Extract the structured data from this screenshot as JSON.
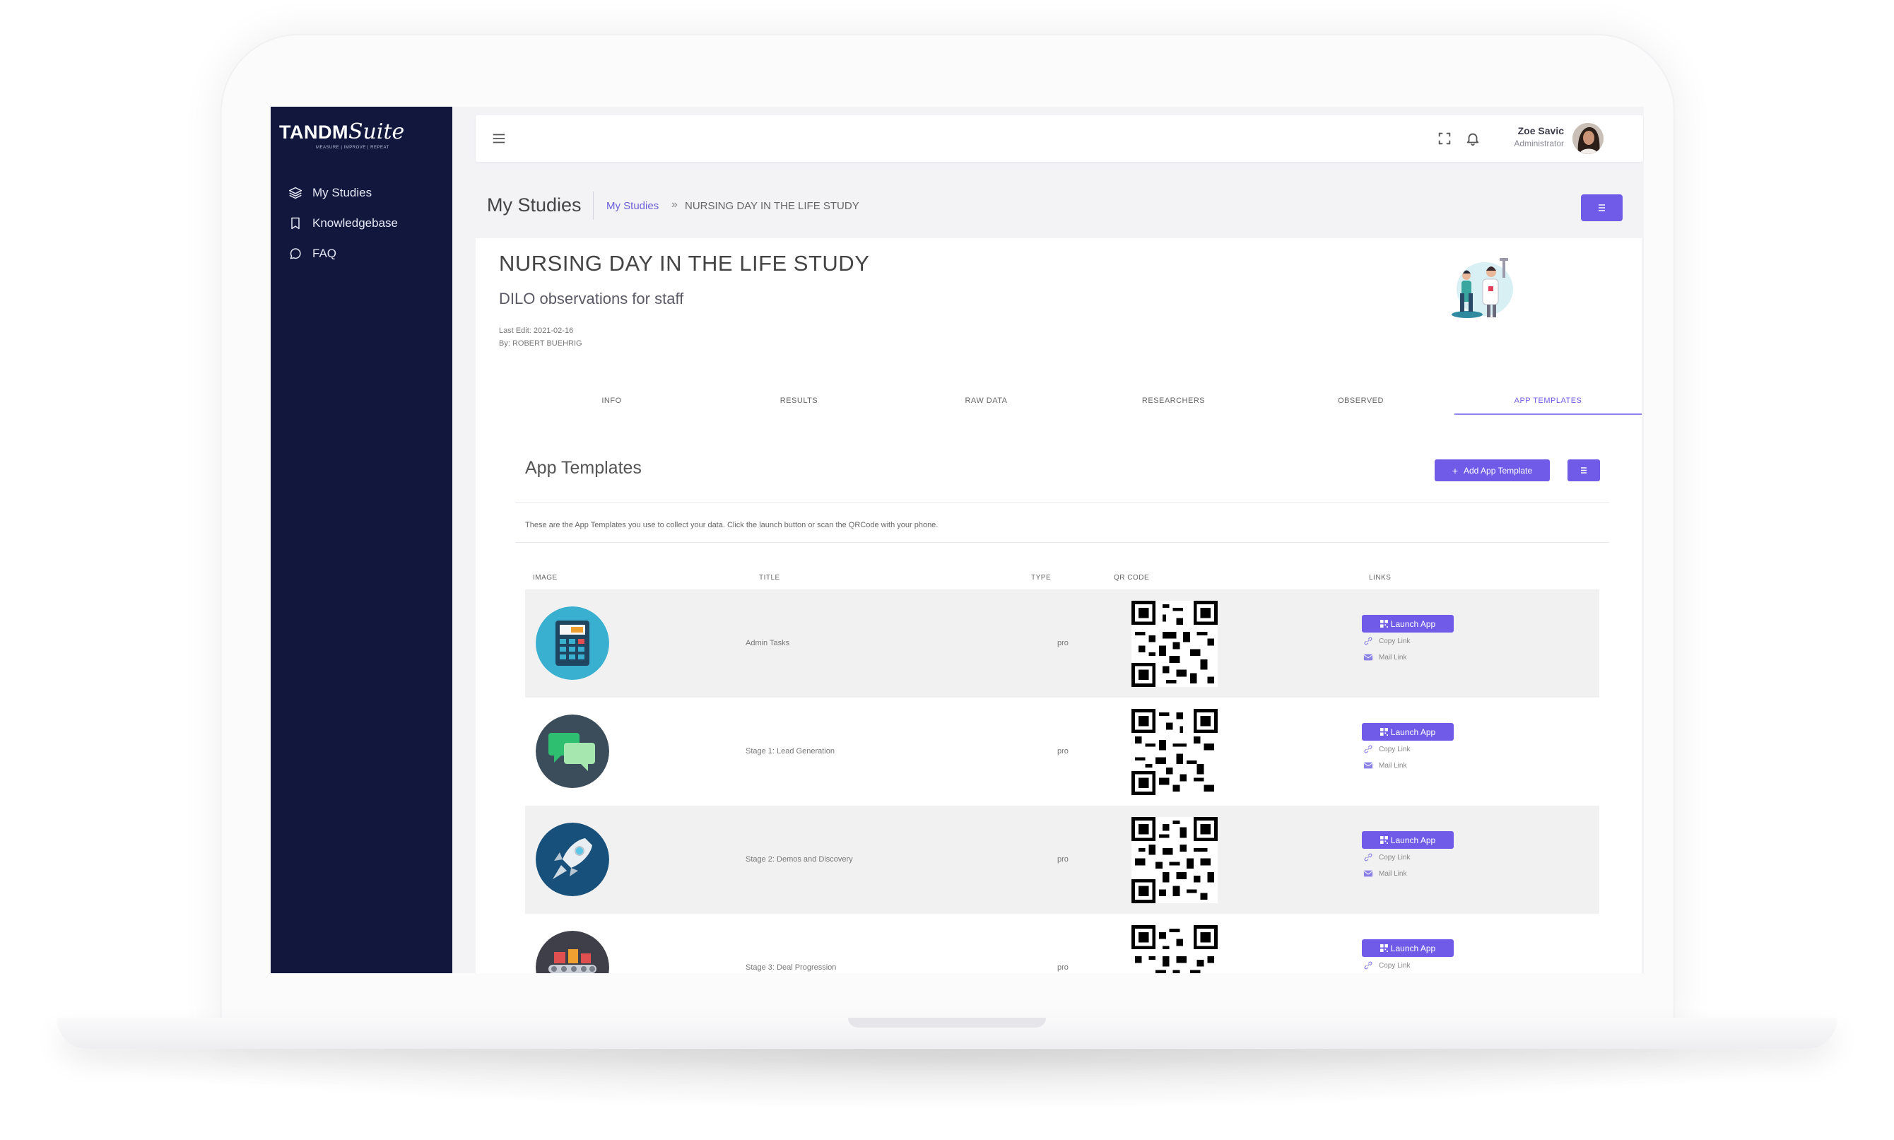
{
  "brand": {
    "logo_main": "TANDM",
    "logo_script": "Suite",
    "logo_tagline": "MEASURE | IMPROVE | REPEAT"
  },
  "sidebar": {
    "items": [
      {
        "label": "My Studies",
        "icon": "layers-icon"
      },
      {
        "label": "Knowledgebase",
        "icon": "bookmark-icon"
      },
      {
        "label": "FAQ",
        "icon": "chat-bubble-icon"
      }
    ]
  },
  "topbar": {
    "user_name": "Zoe Savic",
    "user_role": "Administrator"
  },
  "breadcrumb": {
    "page_title": "My Studies",
    "link": "My Studies",
    "separator": "»",
    "current": "NURSING DAY IN THE LIFE STUDY"
  },
  "study": {
    "title": "NURSING DAY IN THE LIFE STUDY",
    "subtitle": "DILO observations for staff",
    "last_edit": "Last Edit: 2021-02-16",
    "by": "By: ROBERT BUEHRIG"
  },
  "tabs": [
    {
      "label": "INFO",
      "active": false
    },
    {
      "label": "RESULTS",
      "active": false
    },
    {
      "label": "RAW DATA",
      "active": false
    },
    {
      "label": "RESEARCHERS",
      "active": false
    },
    {
      "label": "OBSERVED",
      "active": false
    },
    {
      "label": "APP TEMPLATES",
      "active": true
    }
  ],
  "templates": {
    "title": "App Templates",
    "add_button": "Add App Template",
    "add_button_icon": "+",
    "description": "These are the App Templates you use to collect your data. Click the launch button or scan the QRCode with your phone.",
    "columns": [
      "IMAGE",
      "TITLE",
      "TYPE",
      "QR CODE",
      "LINKS"
    ],
    "launch_label": "Launch App",
    "copy_label": "Copy Link",
    "mail_label": "Mail Link",
    "rows": [
      {
        "title": "Admin Tasks",
        "type": "pro",
        "image": "calculator-icon"
      },
      {
        "title": "Stage 1: Lead Generation",
        "type": "pro",
        "image": "chat-bubbles-icon"
      },
      {
        "title": "Stage 2: Demos and Discovery",
        "type": "pro",
        "image": "rocket-icon"
      },
      {
        "title": "Stage 3: Deal Progression",
        "type": "pro",
        "image": "conveyor-icon"
      }
    ]
  },
  "colors": {
    "sidebar_bg": "#11173d",
    "accent": "#6f5be7",
    "row_shade": "#f1f1f1"
  }
}
